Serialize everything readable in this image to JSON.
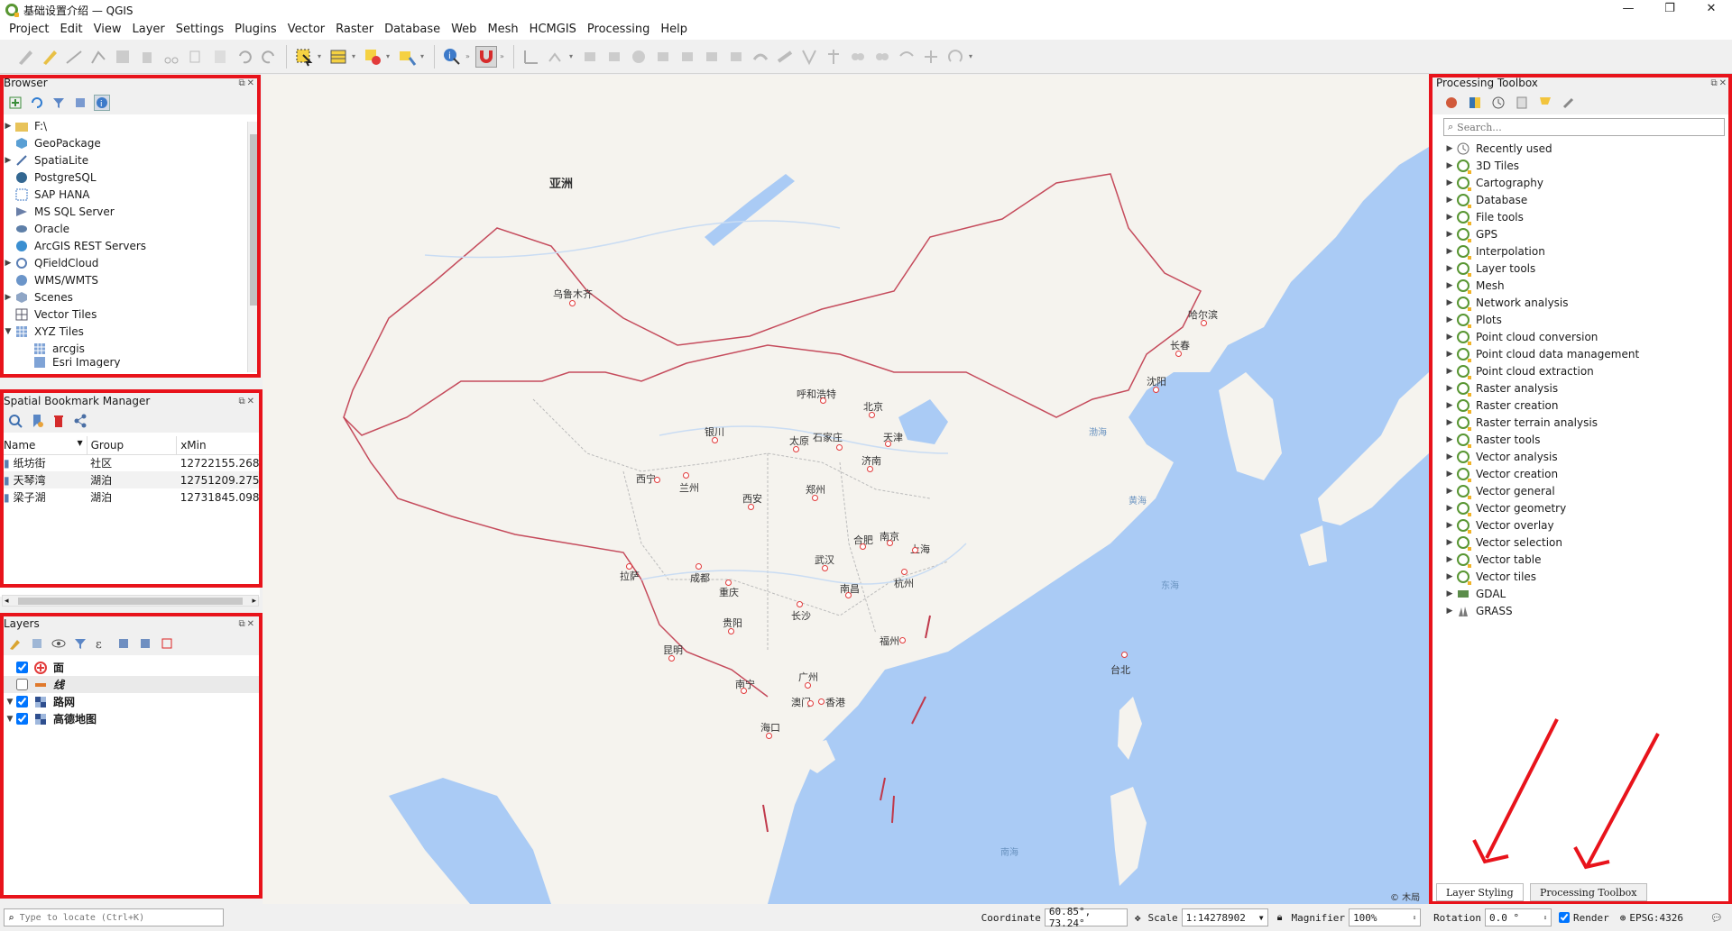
{
  "window": {
    "title": "基础设置介绍 — QGIS",
    "minimize": "—",
    "maximize": "❐",
    "close": "✕"
  },
  "menu": [
    "Project",
    "Edit",
    "View",
    "Layer",
    "Settings",
    "Plugins",
    "Vector",
    "Raster",
    "Database",
    "Web",
    "Mesh",
    "HCMGIS",
    "Processing",
    "Help"
  ],
  "toolbar": {
    "more1": "»",
    "more2": "»"
  },
  "browser": {
    "title": "Browser",
    "items": [
      {
        "label": "F:\\",
        "icon": "folder-icon",
        "expand": "▶"
      },
      {
        "label": "GeoPackage",
        "icon": "geopackage-icon",
        "expand": ""
      },
      {
        "label": "SpatiaLite",
        "icon": "spatialite-icon",
        "expand": "▶"
      },
      {
        "label": "PostgreSQL",
        "icon": "postgresql-icon",
        "expand": ""
      },
      {
        "label": "SAP HANA",
        "icon": "saphana-icon",
        "expand": ""
      },
      {
        "label": "MS SQL Server",
        "icon": "mssql-icon",
        "expand": ""
      },
      {
        "label": "Oracle",
        "icon": "oracle-icon",
        "expand": ""
      },
      {
        "label": "ArcGIS REST Servers",
        "icon": "arcgis-icon",
        "expand": ""
      },
      {
        "label": "QFieldCloud",
        "icon": "qfieldcloud-icon",
        "expand": "▶"
      },
      {
        "label": "WMS/WMTS",
        "icon": "wms-icon",
        "expand": ""
      },
      {
        "label": "Scenes",
        "icon": "scenes-icon",
        "expand": "▶"
      },
      {
        "label": "Vector Tiles",
        "icon": "vector-tiles-icon",
        "expand": ""
      },
      {
        "label": "XYZ Tiles",
        "icon": "xyz-tiles-icon",
        "expand": "▼"
      },
      {
        "label": "arcgis",
        "icon": "xyz-tile-icon",
        "expand": ""
      },
      {
        "label": "Esri Imagery",
        "icon": "xyz-tile-icon",
        "expand": ""
      }
    ]
  },
  "bookmarks": {
    "title": "Spatial Bookmark Manager",
    "columns": [
      "Name",
      "Group",
      "xMin"
    ],
    "rows": [
      {
        "name": "纸坊街",
        "group": "社区",
        "xmin": "12722155.268"
      },
      {
        "name": "天琴湾",
        "group": "湖泊",
        "xmin": "12751209.275"
      },
      {
        "name": "梁子湖",
        "group": "湖泊",
        "xmin": "12731845.098"
      }
    ]
  },
  "layers": {
    "title": "Layers",
    "items": [
      {
        "label": "面",
        "checked": true,
        "expand": ""
      },
      {
        "label": "线",
        "checked": false,
        "expand": ""
      },
      {
        "label": "路网",
        "checked": true,
        "expand": "▼"
      },
      {
        "label": "高德地图",
        "checked": true,
        "expand": "▼"
      }
    ]
  },
  "map": {
    "region_label": "亚洲",
    "cities": [
      "乌鲁木齐",
      "哈尔滨",
      "长春",
      "沈阳",
      "呼和浩特",
      "北京",
      "天津",
      "银川",
      "太原",
      "石家庄",
      "济南",
      "西宁",
      "兰州",
      "郑州",
      "西安",
      "合肥",
      "南京",
      "上海",
      "拉萨",
      "成都",
      "武汉",
      "杭州",
      "重庆",
      "南昌",
      "长沙",
      "贵阳",
      "福州",
      "台北",
      "昆明",
      "南宁",
      "广州",
      "澳门",
      "香港",
      "海口"
    ],
    "seas": [
      "渤海",
      "黄海",
      "东海",
      "南海"
    ],
    "attribution": "© 木局"
  },
  "toolbox": {
    "title": "Processing Toolbox",
    "search_placeholder": "Search...",
    "items": [
      "Recently used",
      "3D Tiles",
      "Cartography",
      "Database",
      "File tools",
      "GPS",
      "Interpolation",
      "Layer tools",
      "Mesh",
      "Network analysis",
      "Plots",
      "Point cloud conversion",
      "Point cloud data management",
      "Point cloud extraction",
      "Raster analysis",
      "Raster creation",
      "Raster terrain analysis",
      "Raster tools",
      "Vector analysis",
      "Vector creation",
      "Vector general",
      "Vector geometry",
      "Vector overlay",
      "Vector selection",
      "Vector table",
      "Vector tiles",
      "GDAL",
      "GRASS"
    ],
    "tabs": [
      "Layer Styling",
      "Processing Toolbox"
    ]
  },
  "status": {
    "locate_placeholder": "Type to locate (Ctrl+K)",
    "coordinate_label": "Coordinate",
    "coordinate": "60.85°, 73.24°",
    "scale_label": "Scale",
    "scale": "1:14278902",
    "magnifier_label": "Magnifier",
    "magnifier": "100%",
    "rotation_label": "Rotation",
    "rotation": "0.0 °",
    "render_label": "Render",
    "crs": "EPSG:4326"
  },
  "colors": {
    "accent_red": "#e8131b",
    "qgis_green": "#589632",
    "water": "#aacbf5",
    "land": "#f5f3ee",
    "border": "#c0394b"
  }
}
